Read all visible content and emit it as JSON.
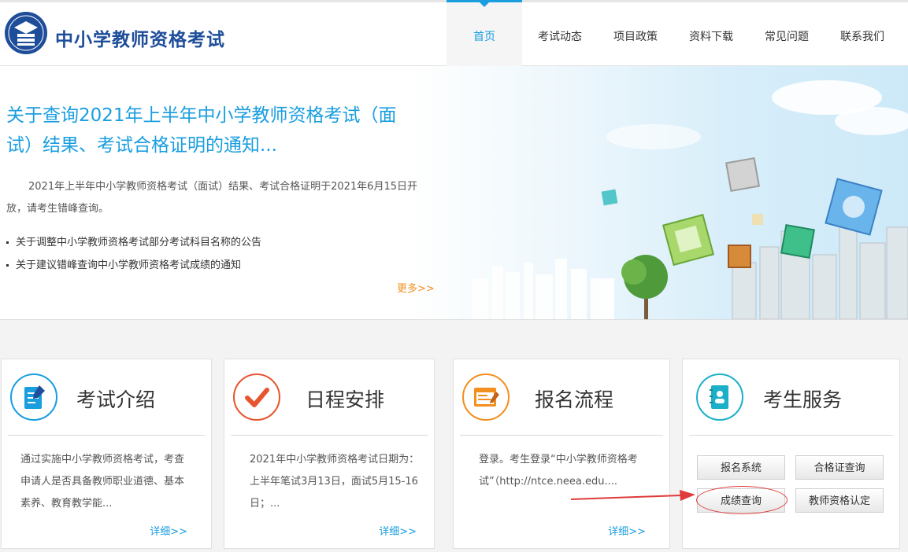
{
  "header": {
    "site_title": "中小学教师资格考试",
    "logo_icon": "neea-badge-icon",
    "nav": [
      {
        "label": "首页",
        "active": true
      },
      {
        "label": "考试动态"
      },
      {
        "label": "项目政策"
      },
      {
        "label": "资料下载"
      },
      {
        "label": "常见问题"
      },
      {
        "label": "联系我们"
      }
    ]
  },
  "hero": {
    "title": "关于查询2021年上半年中小学教师资格考试（面试）结果、考试合格证明的通知...",
    "text": "2021年上半年中小学教师资格考试（面试）结果、考试合格证明于2021年6月15日开放，请考生错峰查询。",
    "links": [
      "关于调整中小学教师资格考试部分考试科目名称的公告",
      "关于建议错峰查询中小学教师资格考试成绩的通知"
    ],
    "more": "更多>>"
  },
  "cards": [
    {
      "title": "考试介绍",
      "icon": "document-edit-icon",
      "body": "通过实施中小学教师资格考试，考查申请人是否具备教师职业道德、基本素养、教育教学能...",
      "more": "详细>>"
    },
    {
      "title": "日程安排",
      "icon": "checkmark-icon",
      "body": "2021年中小学教师资格考试日期为：上半年笔试3月13日，面试5月15-16日；...",
      "more": "详细>>"
    },
    {
      "title": "报名流程",
      "icon": "browser-form-icon",
      "body": "登录。考生登录“中小学教师资格考试”（http://ntce.neea.edu....",
      "more": "详细>>"
    }
  ],
  "service": {
    "title": "考生服务",
    "icon": "contact-book-icon",
    "buttons": [
      "报名系统",
      "合格证查询",
      "成绩查询",
      "教师资格认定"
    ]
  },
  "colors": {
    "accent": "#1a9ee0",
    "title_blue": "#1e4d9a",
    "more_orange": "#f18f1f",
    "annotation_red": "#e03a3a"
  }
}
